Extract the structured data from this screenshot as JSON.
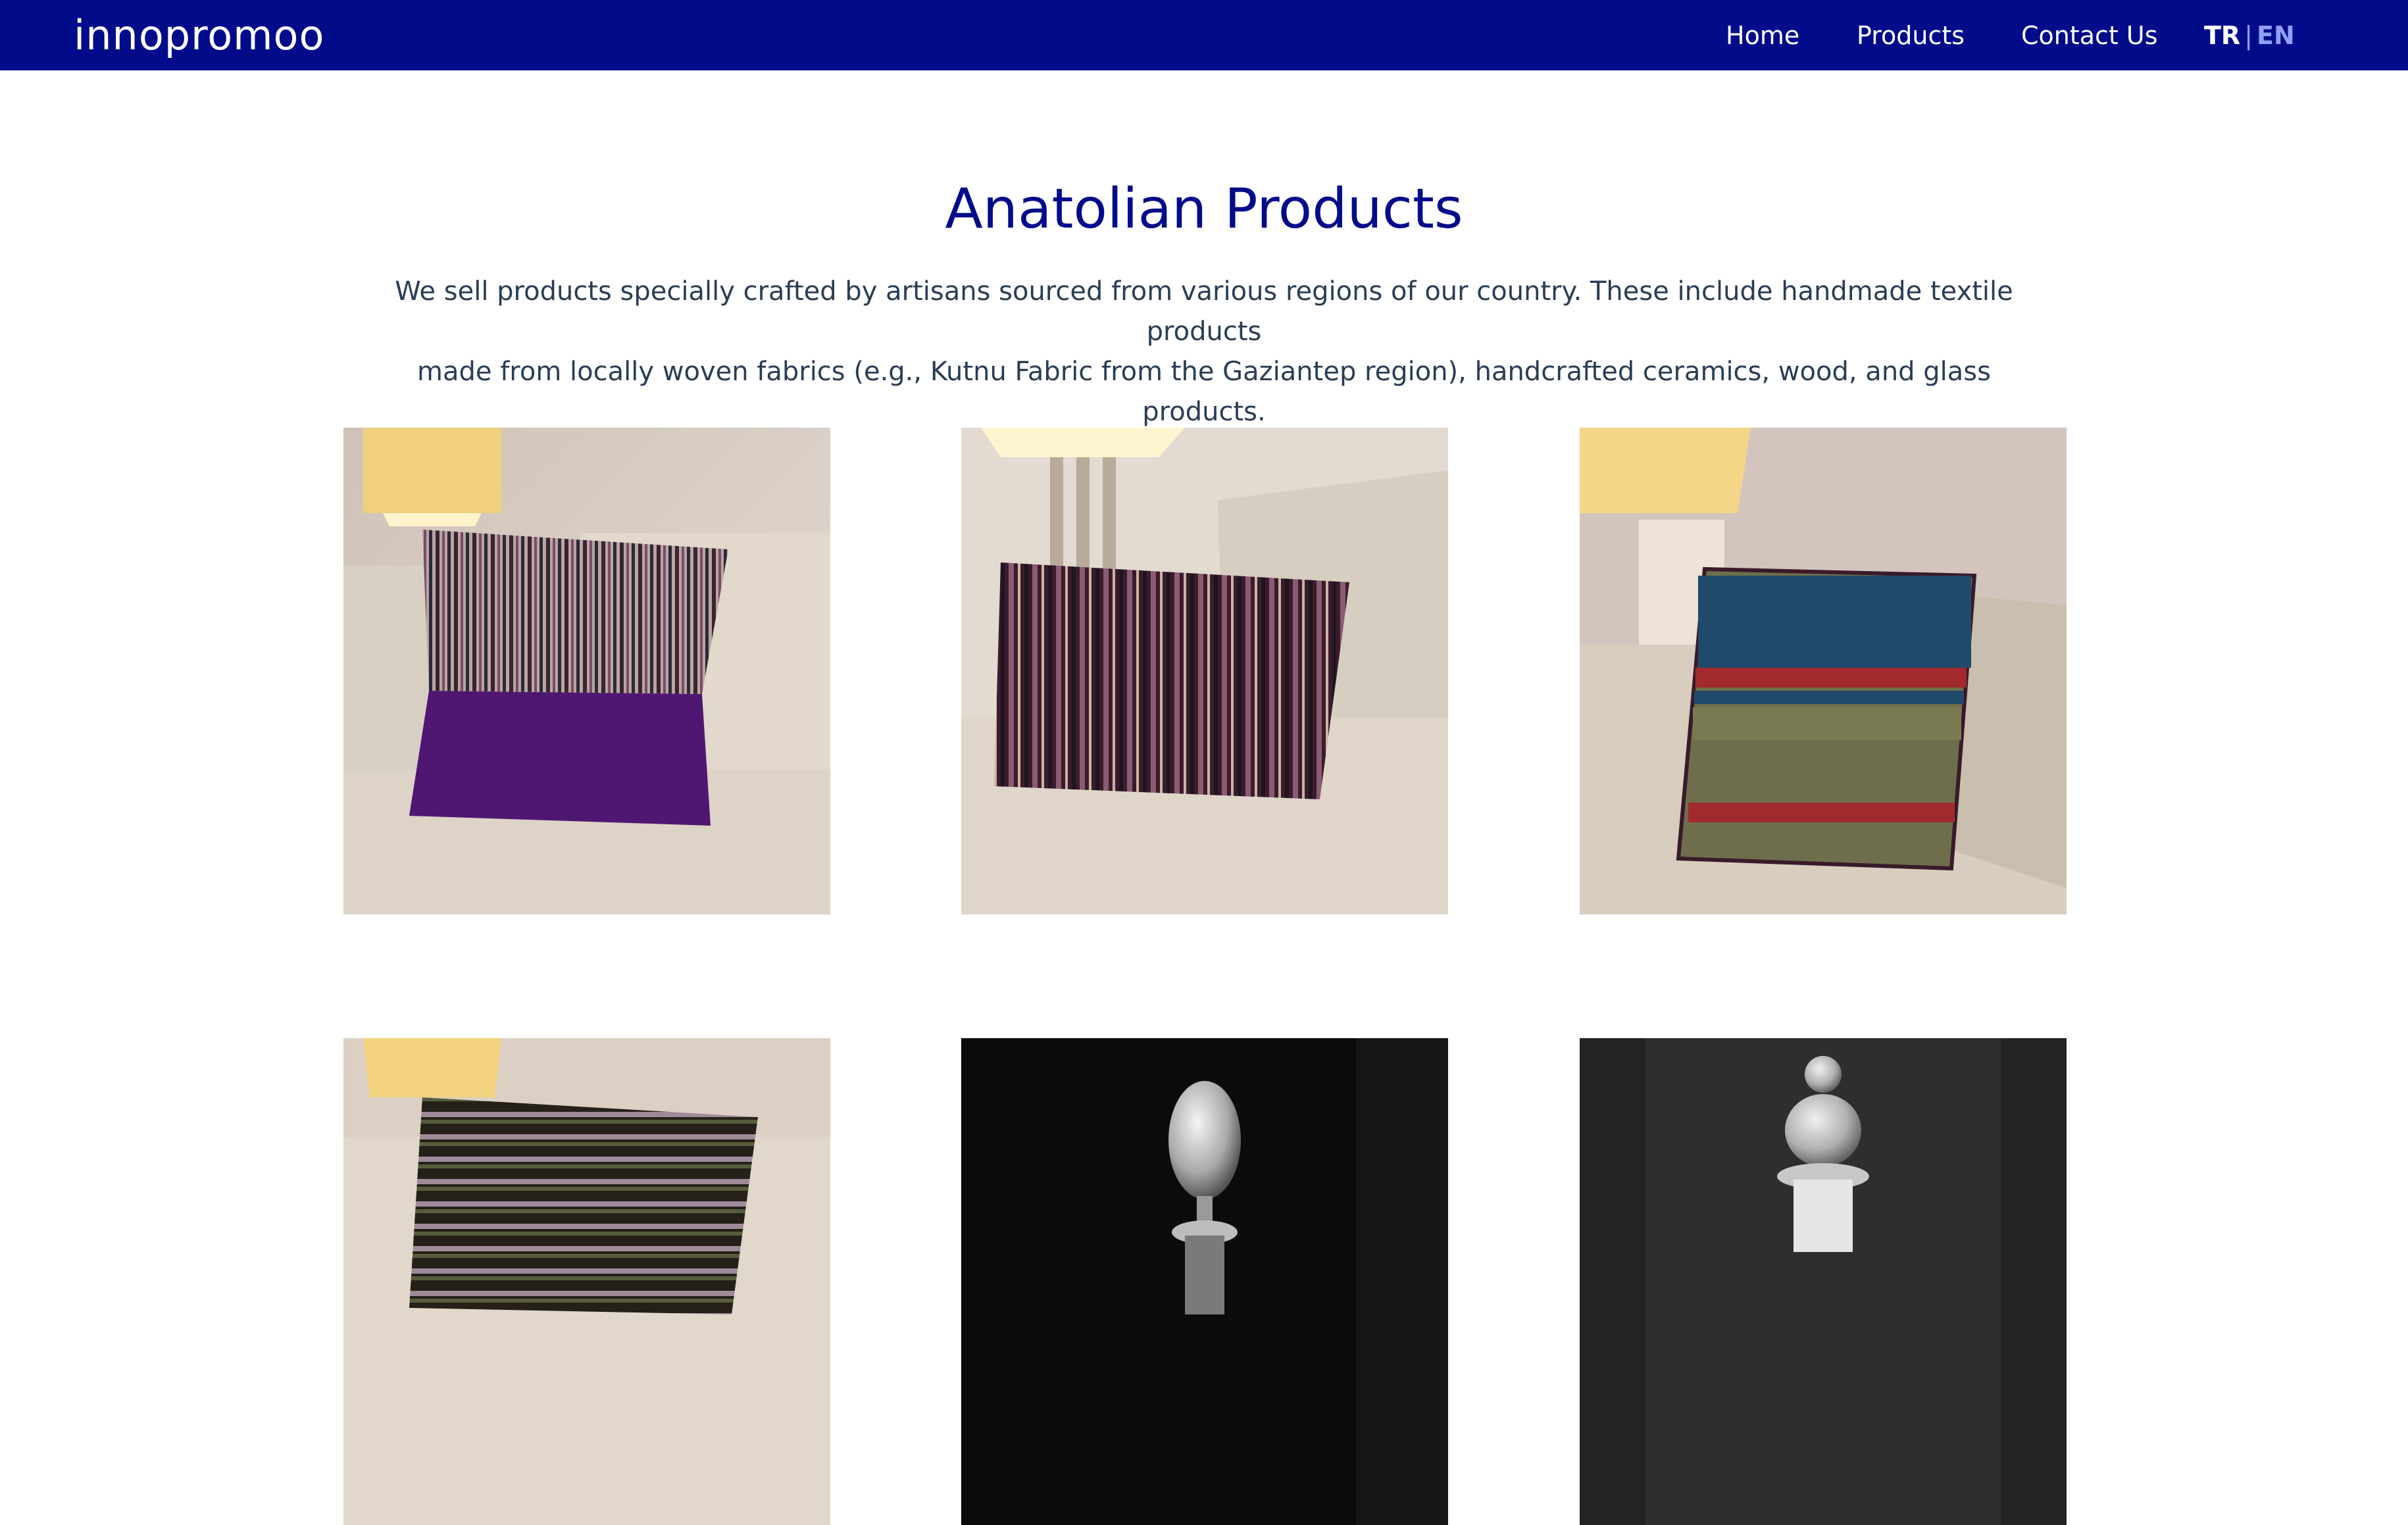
{
  "header": {
    "brand": "innopromoo",
    "nav": [
      "Home",
      "Products",
      "Contact Us"
    ],
    "lang": {
      "tr": "TR",
      "separator": "|",
      "en": "EN"
    }
  },
  "main": {
    "title": "Anatolian Products",
    "intro_line1": "We sell products specially crafted by artisans sourced from various regions of our country. These include handmade textile products",
    "intro_line2": "made from locally woven fabrics (e.g., Kutnu Fabric from the Gaziantep region), handcrafted ceramics, wood, and glass products."
  },
  "colors": {
    "navbar": "#020c8a",
    "title": "#020c8a",
    "body_text": "#2a3d55",
    "lang_inactive": "#8fa0ff"
  }
}
